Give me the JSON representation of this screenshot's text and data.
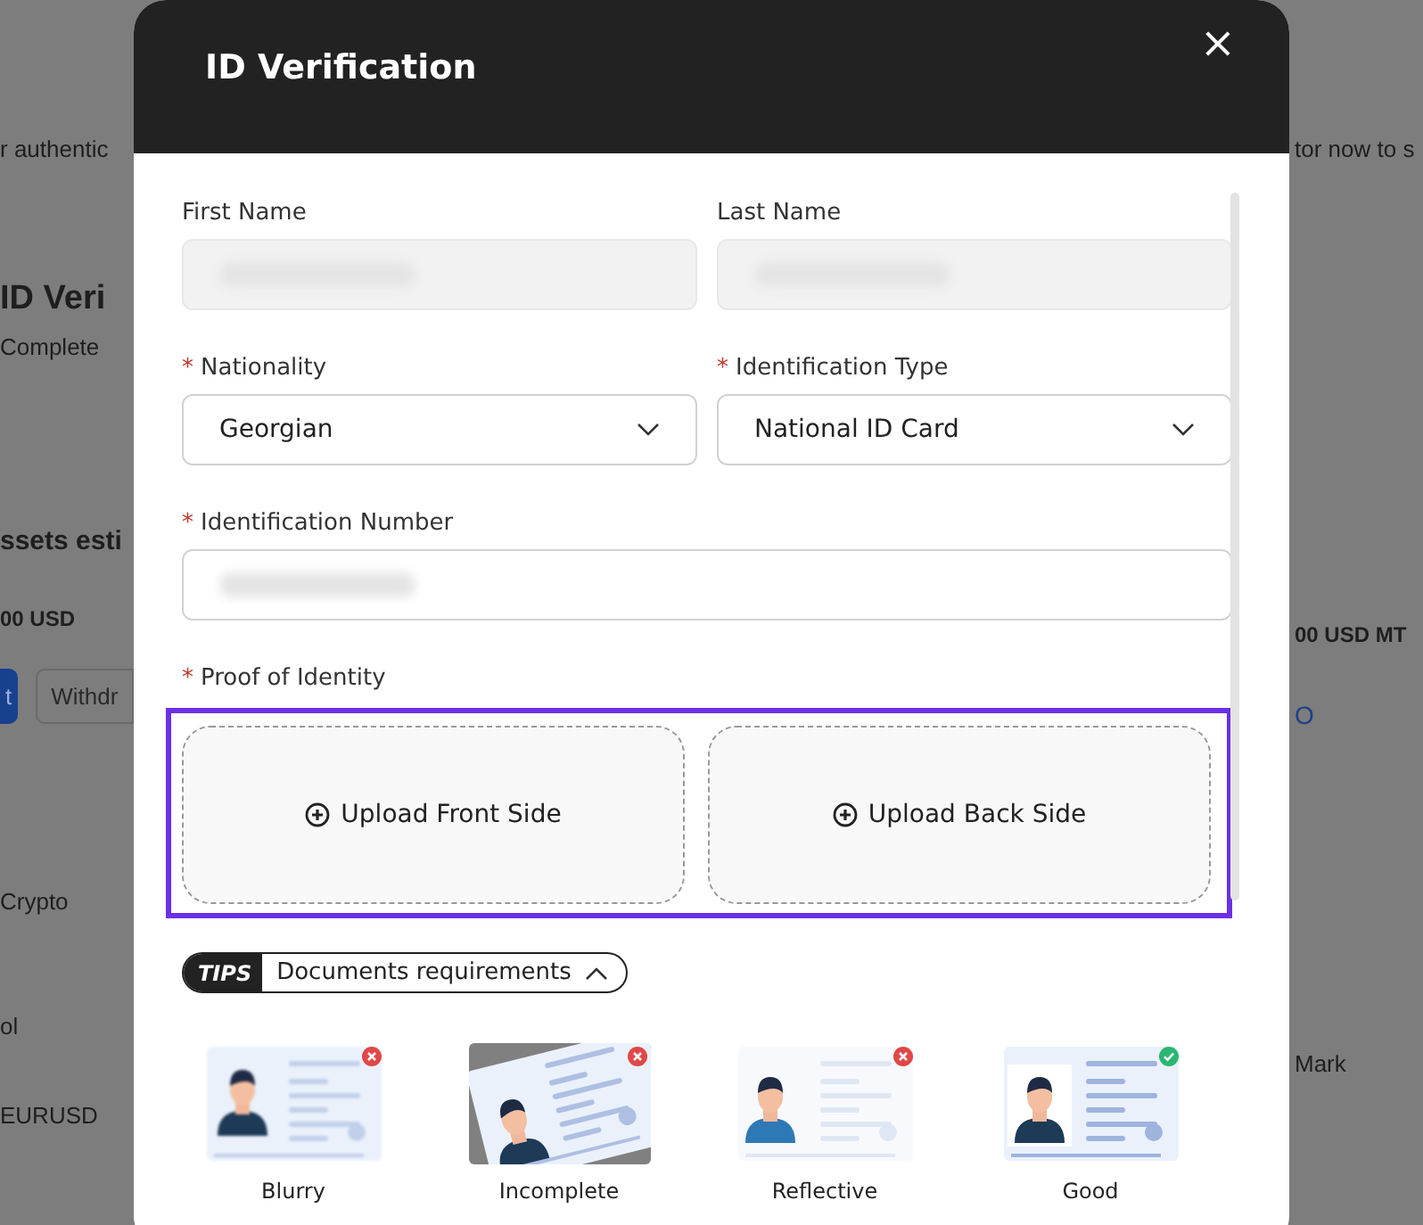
{
  "background": {
    "left": [
      {
        "kind": "text",
        "text": "r authentic"
      },
      {
        "kind": "heading",
        "text": "ID Veri"
      },
      {
        "kind": "text",
        "text": "Complete"
      },
      {
        "kind": "heading2",
        "text": "ssets esti"
      },
      {
        "kind": "amount",
        "text": "00  USD"
      },
      {
        "kind": "buttons",
        "primary": "t",
        "secondary": "Withdr"
      },
      {
        "kind": "text",
        "text": "Crypto"
      },
      {
        "kind": "text",
        "text": "ol"
      },
      {
        "kind": "text",
        "text": "EURUSD"
      }
    ],
    "right": [
      {
        "kind": "text",
        "text": "tor now to s"
      },
      {
        "kind": "amount",
        "text": "00 USD MT"
      },
      {
        "kind": "link",
        "text": "O"
      },
      {
        "kind": "text",
        "text": "Mark"
      }
    ]
  },
  "modal": {
    "title": "ID Verification",
    "close": "×",
    "fields": [
      {
        "kind": "input",
        "label": "First Name",
        "redacted": true,
        "disabled": true
      },
      {
        "kind": "input",
        "label": "Last Name",
        "redacted": true,
        "disabled": true
      },
      {
        "kind": "select",
        "label": "Nationality",
        "required_mark": "*",
        "value": "Georgian"
      },
      {
        "kind": "select",
        "label": "Identification Type",
        "required_mark": "*",
        "value": "National ID Card"
      },
      {
        "kind": "input",
        "label": "Identification Number",
        "required_mark": "*",
        "redacted": true,
        "disabled": false,
        "wide": true
      }
    ],
    "proof": {
      "label": "Proof of Identity",
      "required_mark": "*",
      "highlighted": true,
      "uploads": [
        "Upload Front Side",
        "Upload Back Side"
      ]
    },
    "tips": {
      "badge": "TIPS",
      "label": "Documents requirements",
      "expanded": true,
      "items": [
        {
          "kind": "blurry",
          "label": "Blurry",
          "valid": false
        },
        {
          "kind": "incomplete",
          "label": "Incomplete",
          "valid": false
        },
        {
          "kind": "reflective",
          "label": "Reflective",
          "valid": false
        },
        {
          "kind": "good",
          "label": "Good",
          "valid": true
        }
      ]
    }
  }
}
